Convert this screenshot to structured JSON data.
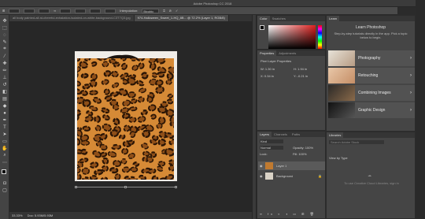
{
  "app": {
    "title": "Adobe Photoshop CC 2018"
  },
  "options": {
    "interpolation_label": "Interpolation:",
    "interpolation_value": "Bicubic"
  },
  "tabs": [
    {
      "label": "all body painted-all at-cheerful-exhalation-isolated-on-white-background-C3T7Q3.jpg",
      "active": false
    },
    {
      "label": "974-Halloween_Sweet_1-HQ_8B... @ 72.2% (Layer 1, RGB/8)",
      "active": true
    }
  ],
  "status": {
    "zoom": "33.33%",
    "doc": "Doc: 5.93M/5.93M"
  },
  "color_panel": {
    "tabs": [
      "Color",
      "Swatches"
    ]
  },
  "properties_panel": {
    "tabs": [
      "Properties",
      "Adjustments"
    ],
    "section": "Pixel Layer Properties",
    "w": "W: 1.30 in",
    "h": "H: 1.94 in",
    "x": "X: 0.34 in",
    "y": "Y: -0.21 in"
  },
  "layers_panel": {
    "tabs": [
      "Layers",
      "Channels",
      "Paths"
    ],
    "filter": "Kind",
    "blend": "Normal",
    "opacity": "Opacity: 100%",
    "lock": "Lock:",
    "fill": "Fill: 100%",
    "layers": [
      {
        "name": "Layer 1"
      },
      {
        "name": "Background"
      }
    ]
  },
  "learn_panel": {
    "tab": "Learn",
    "heading": "Learn Photoshop",
    "description": "Step-by-step tutorials directly in the app. Pick a topic below to begin.",
    "cards": [
      {
        "label": "Photography"
      },
      {
        "label": "Retouching"
      },
      {
        "label": "Combining Images"
      },
      {
        "label": "Graphic Design"
      }
    ]
  },
  "libraries_panel": {
    "tab": "Libraries",
    "search": "Search Adobe Stock",
    "view_by": "View by Type",
    "empty_text": "To use Creative Cloud Libraries, sign in"
  },
  "colors": {
    "panel": "#454545",
    "canvas": "#272727",
    "leopard_base": "#d68a36",
    "spot": "#2a1506"
  }
}
